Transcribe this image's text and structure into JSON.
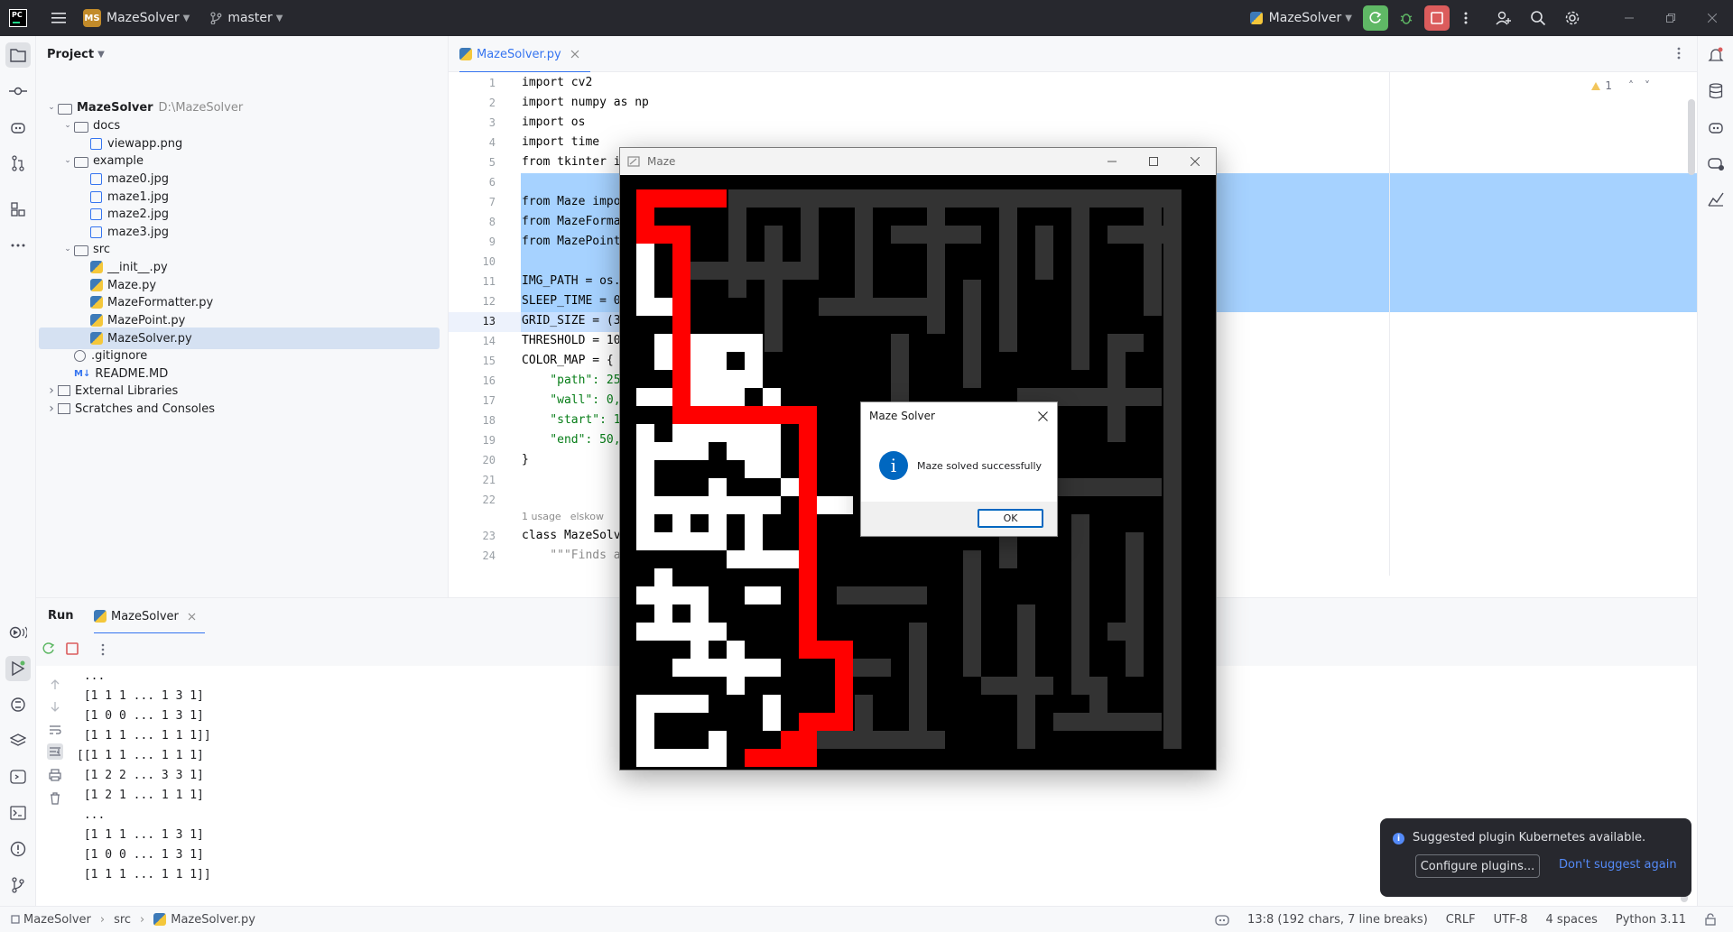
{
  "titlebar": {
    "logo": "PC",
    "project_badge": "MS",
    "project": "MazeSolver",
    "branch": "master",
    "run_config": "MazeSolver"
  },
  "project_panel": {
    "title": "Project",
    "tree": [
      {
        "label": "MazeSolver",
        "suffix": "D:\\MazeSolver",
        "type": "root"
      },
      {
        "label": "docs",
        "type": "folder"
      },
      {
        "label": "viewapp.png",
        "type": "image"
      },
      {
        "label": "example",
        "type": "folder"
      },
      {
        "label": "maze0.jpg",
        "type": "image"
      },
      {
        "label": "maze1.jpg",
        "type": "image"
      },
      {
        "label": "maze2.jpg",
        "type": "image"
      },
      {
        "label": "maze3.jpg",
        "type": "image"
      },
      {
        "label": "src",
        "type": "folder"
      },
      {
        "label": "__init__.py",
        "type": "python"
      },
      {
        "label": "Maze.py",
        "type": "python"
      },
      {
        "label": "MazeFormatter.py",
        "type": "python"
      },
      {
        "label": "MazePoint.py",
        "type": "python"
      },
      {
        "label": "MazeSolver.py",
        "type": "python",
        "selected": true
      },
      {
        "label": ".gitignore",
        "type": "git"
      },
      {
        "label": "README.MD",
        "type": "md"
      },
      {
        "label": "External Libraries",
        "type": "lib"
      },
      {
        "label": "Scratches and Consoles",
        "type": "scratch"
      }
    ]
  },
  "editor": {
    "tab": "MazeSolver.py",
    "warnings": "1",
    "line_numbers": [
      "1",
      "2",
      "3",
      "4",
      "5",
      "6",
      "7",
      "8",
      "9",
      "10",
      "11",
      "12",
      "13",
      "14",
      "15",
      "16",
      "17",
      "18",
      "19",
      "20",
      "21",
      "22",
      "23",
      "24"
    ],
    "lines": [
      "import cv2",
      "import numpy as np",
      "import os",
      "import time",
      "from tkinter i",
      "",
      "from Maze impo",
      "from MazeForma",
      "from MazePoint",
      "",
      "IMG_PATH = os.",
      "SLEEP_TIME = 0",
      "GRID_SIZE = (3",
      "THRESHOLD = 10",
      "COLOR_MAP = {",
      "    \"path\": 25",
      "    \"wall\": 0,",
      "    \"start\": 1",
      "    \"end\": 50,",
      "}",
      "",
      "",
      "class MazeSolv",
      "    \"\"\"Finds a"
    ],
    "inlay_usage": "1 usage",
    "inlay_author": "elskow"
  },
  "run_panel": {
    "title": "Run",
    "tab": "MazeSolver",
    "output": [
      " ...",
      " [1 1 1 ... 1 3 1]",
      " [1 0 0 ... 1 3 1]",
      " [1 1 1 ... 1 1 1]]",
      "[[1 1 1 ... 1 1 1]",
      " [1 2 2 ... 3 3 1]",
      " [1 2 1 ... 1 1 1]",
      " ...",
      " [1 1 1 ... 1 3 1]",
      " [1 0 0 ... 1 3 1]",
      " [1 1 1 ... 1 1 1]]"
    ]
  },
  "maze_window": {
    "title": "Maze"
  },
  "dialog": {
    "title": "Maze Solver",
    "message": "Maze solved successfully",
    "ok": "OK"
  },
  "notification": {
    "message": "Suggested plugin Kubernetes available.",
    "configure": "Configure plugins...",
    "dismiss": "Don't suggest again"
  },
  "statusbar": {
    "crumbs": [
      "MazeSolver",
      "src",
      "MazeSolver.py"
    ],
    "position": "13:8 (192 chars, 7 line breaks)",
    "line_sep": "CRLF",
    "encoding": "UTF-8",
    "indent": "4 spaces",
    "interpreter": "Python 3.11"
  },
  "colors": {
    "accent": "#3574f0",
    "selection": "#a6d2ff",
    "titlebar": "#27282e",
    "maze_path": "#ff0000",
    "maze_visited": "#ffffff",
    "maze_wall": "#333333"
  }
}
